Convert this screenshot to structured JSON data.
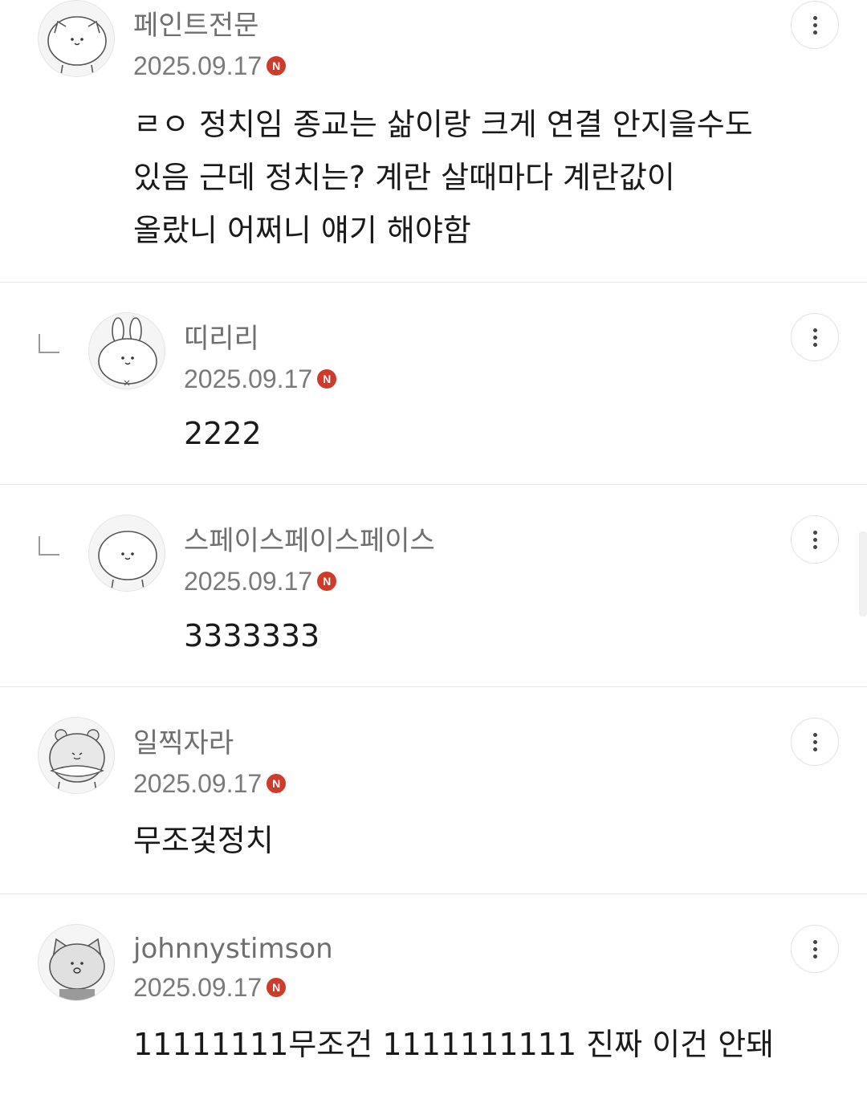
{
  "comments": [
    {
      "nickname": "페인트전문",
      "date": "2025.09.17",
      "new_badge": "N",
      "text": "ㄹㅇ 정치임 종교는 삶이랑 크게 연결 안지을수도\n있음 근데 정치는? 계란 살때마다 계란값이\n올랐니 어쩌니 얘기 해야함",
      "avatar_icon": "cat-avatar-icon",
      "is_reply": false
    },
    {
      "nickname": "띠리리",
      "date": "2025.09.17",
      "new_badge": "N",
      "text": "2222",
      "avatar_icon": "rabbit-avatar-icon",
      "is_reply": true
    },
    {
      "nickname": "스페이스페이스페이스",
      "date": "2025.09.17",
      "new_badge": "N",
      "text": "3333333",
      "avatar_icon": "cat-avatar-icon",
      "is_reply": true
    },
    {
      "nickname": "일찍자라",
      "date": "2025.09.17",
      "new_badge": "N",
      "text": "무조겇정치",
      "avatar_icon": "bear-avatar-icon",
      "is_reply": false
    },
    {
      "nickname": "johnnystimson",
      "date": "2025.09.17",
      "new_badge": "N",
      "text": "11111111무조건 1111111111 진짜 이건 안돼",
      "avatar_icon": "fox-avatar-icon",
      "is_reply": false
    }
  ],
  "colors": {
    "badge": "#cf3b2a",
    "divider": "#e6e6e6",
    "nickname": "#6f6f6f",
    "text": "#1a1a1a"
  }
}
